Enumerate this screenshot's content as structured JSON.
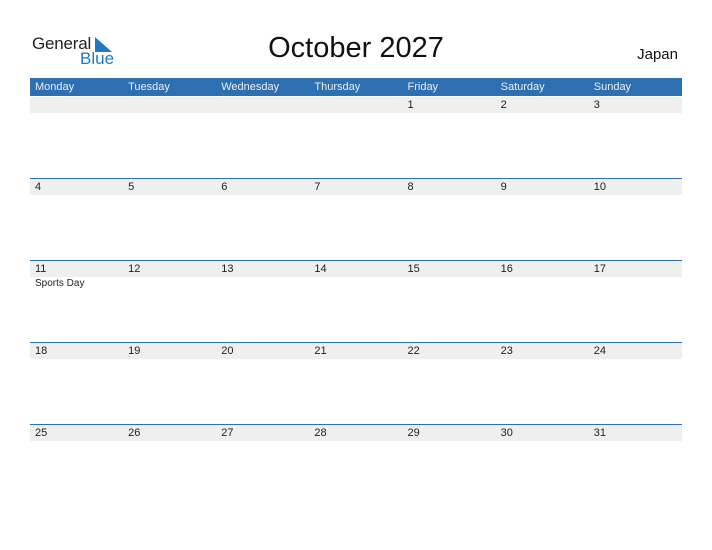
{
  "logo": {
    "general": "General",
    "blue": "Blue",
    "accent_color": "#1f7ac2"
  },
  "title": "October 2027",
  "country": "Japan",
  "header_color": "#2e6fb1",
  "weekdays": [
    "Monday",
    "Tuesday",
    "Wednesday",
    "Thursday",
    "Friday",
    "Saturday",
    "Sunday"
  ],
  "weeks": [
    {
      "days": [
        "",
        "",
        "",
        "",
        "1",
        "2",
        "3"
      ],
      "events": [
        "",
        "",
        "",
        "",
        "",
        "",
        ""
      ]
    },
    {
      "days": [
        "4",
        "5",
        "6",
        "7",
        "8",
        "9",
        "10"
      ],
      "events": [
        "",
        "",
        "",
        "",
        "",
        "",
        ""
      ]
    },
    {
      "days": [
        "11",
        "12",
        "13",
        "14",
        "15",
        "16",
        "17"
      ],
      "events": [
        "Sports Day",
        "",
        "",
        "",
        "",
        "",
        ""
      ]
    },
    {
      "days": [
        "18",
        "19",
        "20",
        "21",
        "22",
        "23",
        "24"
      ],
      "events": [
        "",
        "",
        "",
        "",
        "",
        "",
        ""
      ]
    },
    {
      "days": [
        "25",
        "26",
        "27",
        "28",
        "29",
        "30",
        "31"
      ],
      "events": [
        "",
        "",
        "",
        "",
        "",
        "",
        ""
      ]
    }
  ]
}
